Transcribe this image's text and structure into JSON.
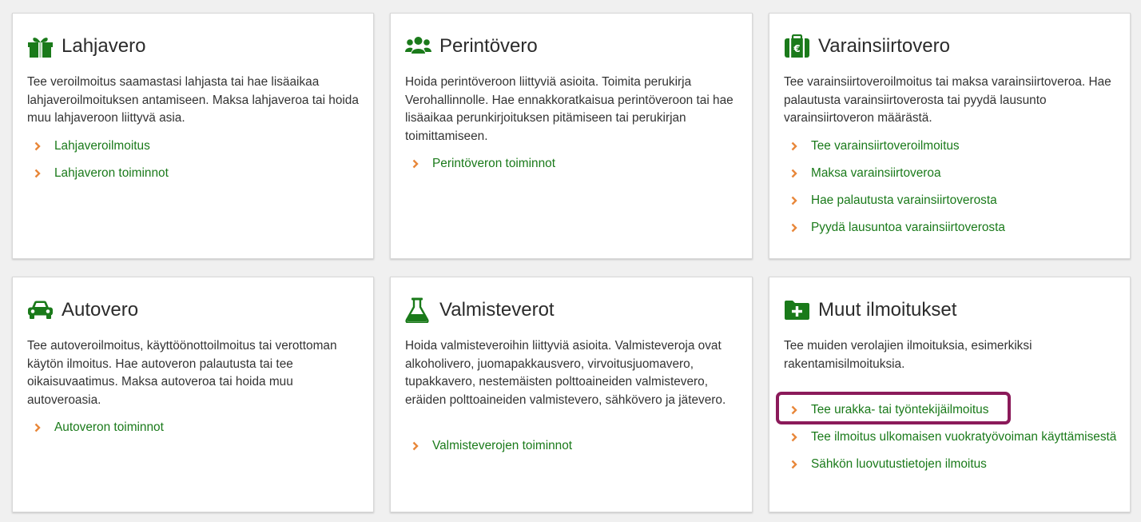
{
  "colors": {
    "green": "#1a7a1a",
    "chevron": "#e8873a",
    "highlight": "#8b1a5a",
    "background": "#f0f0f0"
  },
  "cards": [
    {
      "icon": "gift-icon",
      "title": "Lahjavero",
      "description": "Tee veroilmoitus saamastasi lahjasta tai hae lisäaikaa lahjaveroilmoituksen antamiseen. Maksa lahjaveroa tai hoida muu lahjaveroon liittyvä asia.",
      "links": [
        "Lahjaveroilmoitus",
        "Lahjaveron toiminnot"
      ]
    },
    {
      "icon": "people-icon",
      "title": "Perintövero",
      "description": "Hoida perintöveroon liittyviä asioita. Toimita perukirja Verohallinnolle. Hae ennakkoratkaisua perintöveroon tai hae lisäaikaa perunkirjoituksen pitämiseen tai perukirjan toimittamiseen.",
      "links": [
        "Perintöveron toiminnot"
      ]
    },
    {
      "icon": "euro-luggage-icon",
      "title": "Varainsiirtovero",
      "description": "Tee varainsiirtoveroilmoitus tai maksa varainsiirtoveroa. Hae palautusta varainsiirtoverosta tai pyydä lausunto varainsiirtoveron määrästä.",
      "links": [
        "Tee varainsiirtoveroilmoitus",
        "Maksa varainsiirtoveroa",
        "Hae palautusta varainsiirtoverosta",
        "Pyydä lausuntoa varainsiirtoverosta"
      ]
    },
    {
      "icon": "car-icon",
      "title": "Autovero",
      "description": "Tee autoveroilmoitus, käyttöönottoilmoitus tai verottoman käytön ilmoitus. Hae autoveron palautusta tai tee oikaisuvaatimus. Maksa autoveroa tai hoida muu autoveroasia.",
      "links": [
        "Autoveron toiminnot"
      ]
    },
    {
      "icon": "flask-icon",
      "title": "Valmisteverot",
      "description": "Hoida valmisteveroihin liittyviä asioita. Valmisteveroja ovat alkoholivero, juomapakkausvero, virvoitusjuomavero, tupakkavero, nestemäisten polttoaineiden valmistevero, eräiden polttoaineiden valmistevero, sähkövero ja jätevero.",
      "links": [
        "Valmisteverojen toiminnot"
      ]
    },
    {
      "icon": "folder-plus-icon",
      "title": "Muut ilmoitukset",
      "description": "Tee muiden verolajien ilmoituksia, esimerkiksi rakentamisilmoituksia.",
      "links": [
        "Tee urakka- tai työntekijäilmoitus",
        "Tee ilmoitus ulkomaisen vuokratyövoiman käyttämisestä",
        "Sähkön luovutustietojen ilmoitus"
      ]
    }
  ]
}
